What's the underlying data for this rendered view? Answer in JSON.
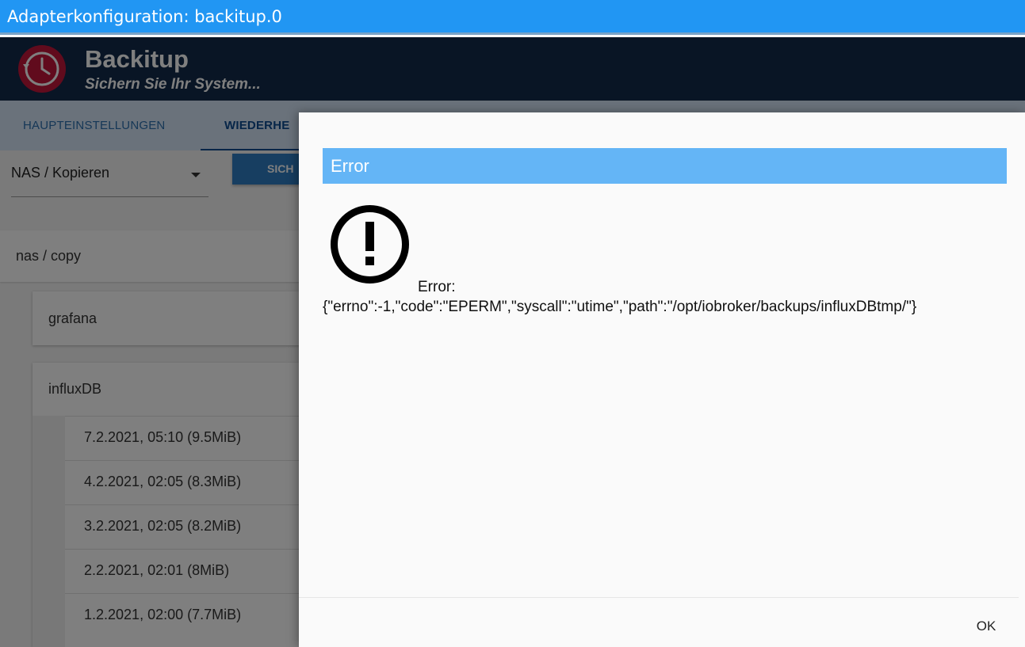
{
  "window": {
    "title": "Adapterkonfiguration: backitup.0"
  },
  "header": {
    "app_name": "Backitup",
    "subtitle": "Sichern Sie Ihr System...",
    "logo_icon": "clock-history-icon",
    "logo_color": "#c3163a"
  },
  "tabs": [
    {
      "label": "HAUPTEINSTELLUNGEN"
    },
    {
      "label": "WIEDERHE"
    }
  ],
  "content": {
    "storage_select": {
      "value": "NAS / Kopieren"
    },
    "backup_button": {
      "label": "SICH"
    },
    "storage_panel": {
      "label": "nas / copy"
    },
    "groups": [
      {
        "label": "grafana"
      },
      {
        "label": "influxDB"
      }
    ],
    "backups": [
      {
        "label": "7.2.2021, 05:10 (9.5MiB)"
      },
      {
        "label": "4.2.2021, 02:05 (8.3MiB)"
      },
      {
        "label": "3.2.2021, 02:05 (8.2MiB)"
      },
      {
        "label": "2.2.2021, 02:01 (8MiB)"
      },
      {
        "label": "1.2.2021, 02:00 (7.7MiB)"
      }
    ]
  },
  "dialog": {
    "title": "Error",
    "icon": "error-exclamation-icon",
    "message_line1": "Error:",
    "message_line2": "{\"errno\":-1,\"code\":\"EPERM\",\"syscall\":\"utime\",\"path\":\"/opt/iobroker/backups/influxDBtmp/\"}",
    "ok_label": "OK",
    "title_color": "#64b5f6"
  },
  "colors": {
    "titlebar": "#2196f3",
    "header": "#122b4a",
    "accent": "#2f7dc2"
  }
}
